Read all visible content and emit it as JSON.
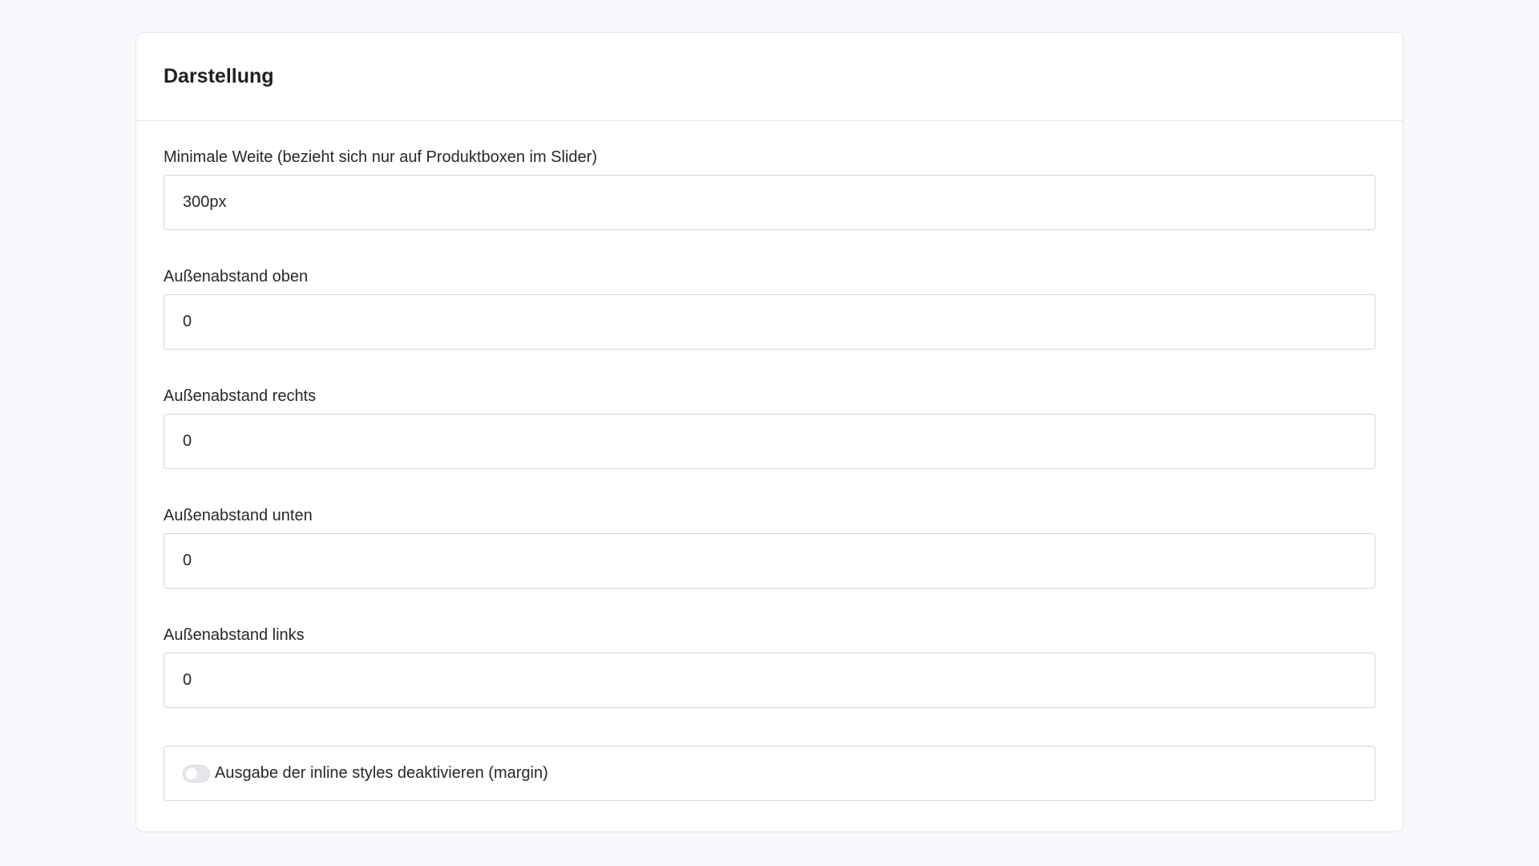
{
  "card": {
    "title": "Darstellung"
  },
  "fields": [
    {
      "label": "Minimale Weite (bezieht sich nur auf Produktboxen im Slider)",
      "value": "300px"
    },
    {
      "label": "Außenabstand oben",
      "value": "0"
    },
    {
      "label": "Außenabstand rechts",
      "value": "0"
    },
    {
      "label": "Außenabstand unten",
      "value": "0"
    },
    {
      "label": "Außenabstand links",
      "value": "0"
    }
  ],
  "toggle": {
    "label": "Ausgabe der inline styles deaktivieren (margin)",
    "checked": false
  },
  "colors": {
    "background": "#f8f9fc",
    "card": "#ffffff",
    "border": "#d3d6dc",
    "text": "#25282c"
  }
}
